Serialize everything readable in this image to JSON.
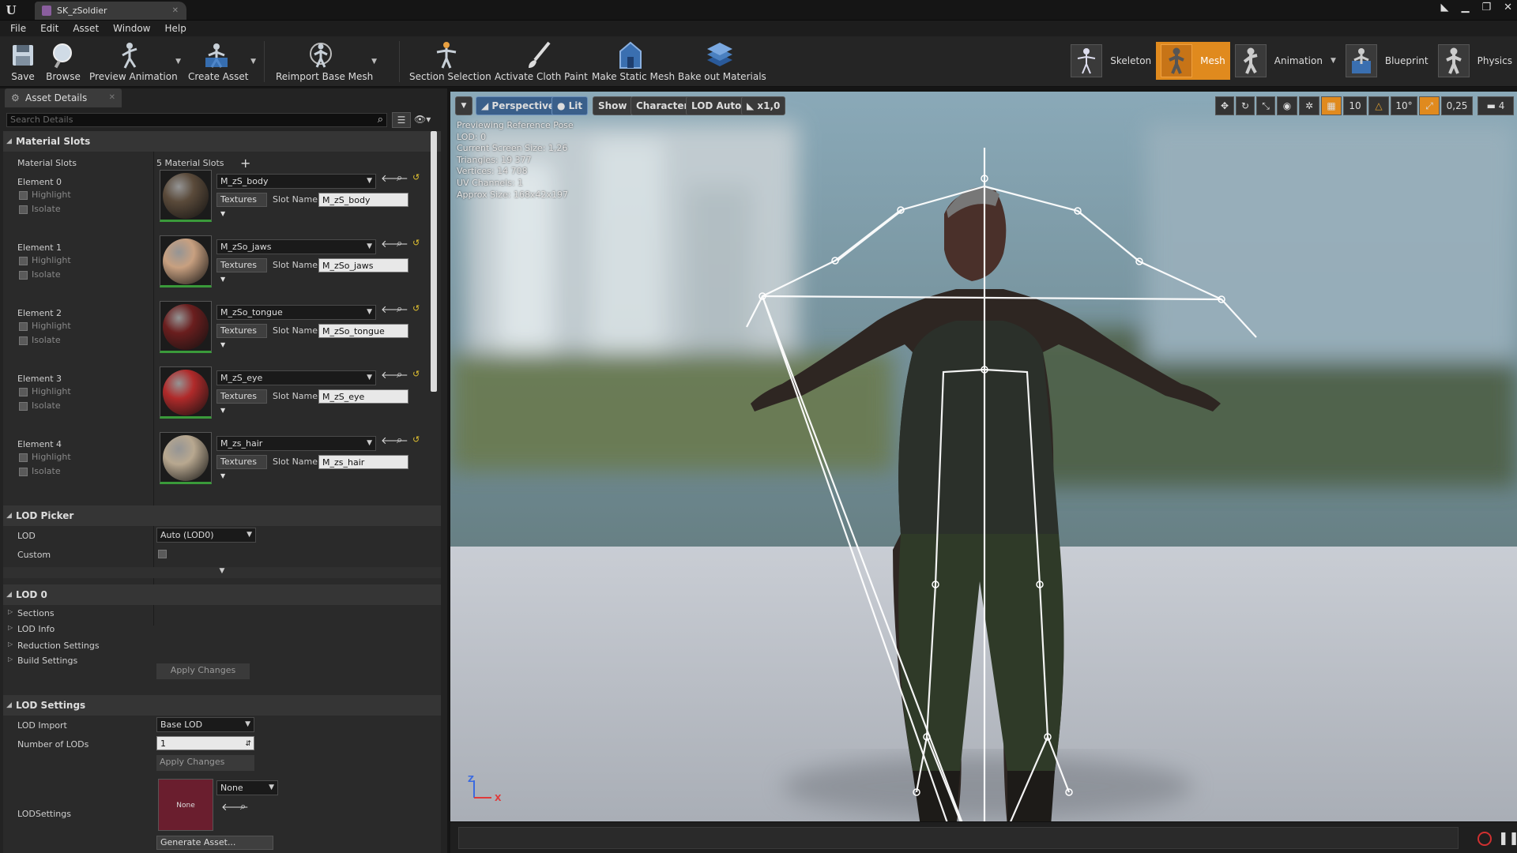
{
  "window": {
    "tab_title": "SK_zSoldier",
    "menu": [
      "File",
      "Edit",
      "Asset",
      "Window",
      "Help"
    ]
  },
  "toolbar": {
    "save": "Save",
    "browse": "Browse",
    "preview_animation": "Preview Animation",
    "create_asset": "Create Asset",
    "reimport": "Reimport Base Mesh",
    "section_selection": "Section Selection",
    "activate_cloth": "Activate Cloth Paint",
    "make_static": "Make Static Mesh",
    "bake_out": "Bake out Materials"
  },
  "modes": {
    "skeleton": "Skeleton",
    "mesh": "Mesh",
    "animation": "Animation",
    "blueprint": "Blueprint",
    "physics": "Physics"
  },
  "details": {
    "tab": "Asset Details",
    "search_placeholder": "Search Details",
    "material_slots_header": "Material Slots",
    "material_slots_label": "Material Slots",
    "material_slots_count": "5 Material Slots",
    "highlight": "Highlight",
    "isolate": "Isolate",
    "textures": "Textures",
    "slot_name": "Slot Name",
    "elements": [
      {
        "label": "Element 0",
        "material": "M_zS_body",
        "slot": "M_zS_body",
        "color": "#5a4a3a"
      },
      {
        "label": "Element 1",
        "material": "M_zSo_jaws",
        "slot": "M_zSo_jaws",
        "color": "#c8a080"
      },
      {
        "label": "Element 2",
        "material": "M_zSo_tongue",
        "slot": "M_zSo_tongue",
        "color": "#6a1e1e"
      },
      {
        "label": "Element 3",
        "material": "M_zS_eye",
        "slot": "M_zS_eye",
        "color": "#b02a2a"
      },
      {
        "label": "Element 4",
        "material": "M_zs_hair",
        "slot": "M_zs_hair",
        "color": "#b8a890"
      }
    ],
    "lod_picker_header": "LOD Picker",
    "lod_label": "LOD",
    "lod_value": "Auto (LOD0)",
    "custom_label": "Custom",
    "lod0_header": "LOD 0",
    "lod0_items": [
      "Sections",
      "LOD Info",
      "Reduction Settings",
      "Build Settings"
    ],
    "apply_changes": "Apply Changes",
    "lod_settings_header": "LOD Settings",
    "lod_import_label": "LOD Import",
    "lod_import_value": "Base LOD",
    "num_lods_label": "Number of LODs",
    "num_lods_value": "1",
    "lodsettings_label": "LODSettings",
    "lodsettings_thumb": "None",
    "lodsettings_value": "None",
    "generate_asset": "Generate Asset..."
  },
  "viewport": {
    "perspective": "Perspective",
    "lit": "Lit",
    "show": "Show",
    "character": "Character",
    "lod_auto": "LOD Auto",
    "speed": "x1,0",
    "grid_snap": "10",
    "rot_snap": "10°",
    "scale_snap": "0,25",
    "cam_speed": "4",
    "stats": [
      "Previewing Reference Pose",
      "LOD: 0",
      "Current Screen Size: 1,26",
      "Triangles: 19 377",
      "Vertices: 14 708",
      "UV Channels: 1",
      "Approx Size: 168x42x197"
    ],
    "axis_z": "Z",
    "axis_x": "X"
  }
}
